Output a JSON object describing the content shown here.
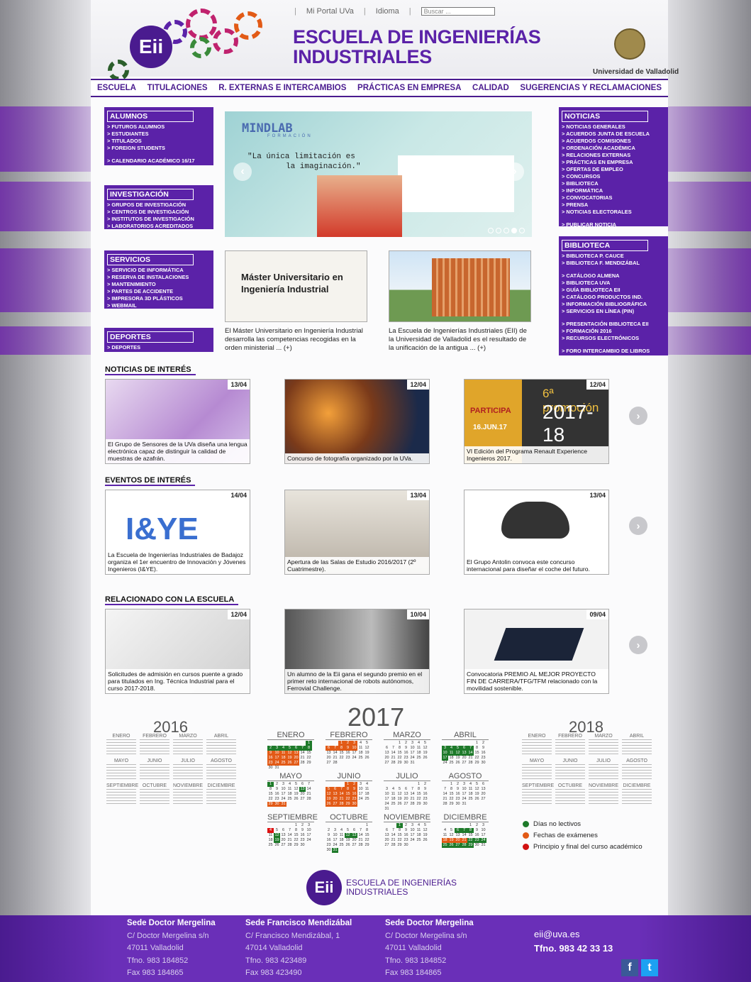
{
  "header": {
    "links": [
      "Mi Portal UVa",
      "Idioma"
    ],
    "search_placeholder": "Buscar ...",
    "title_line1": "ESCUELA DE INGENIERÍAS",
    "title_line2": "INDUSTRIALES",
    "logo_text": "Eii",
    "university": "Universidad de Valladolid"
  },
  "nav": [
    "ESCUELA",
    "TITULACIONES",
    "R. EXTERNAS E INTERCAMBIOS",
    "PRÁCTICAS EN EMPRESA",
    "CALIDAD",
    "SUGERENCIAS Y RECLAMACIONES"
  ],
  "left_boxes": [
    {
      "title": "ALUMNOS",
      "items": [
        "> FUTUROS ALUMNOS",
        "> ESTUDIANTES",
        "> TITULADOS",
        "> FOREIGN STUDENTS",
        "",
        "> CALENDARIO ACADÉMICO 16/17"
      ]
    },
    {
      "title": "INVESTIGACIÓN",
      "items": [
        "> GRUPOS DE INVESTIGACIÓN",
        "> CENTROS DE INVESTIGACIÓN",
        "> INSTITUTOS DE INVESTIGACIÓN",
        "> LABORATORIOS ACREDITADOS"
      ]
    },
    {
      "title": "SERVICIOS",
      "items": [
        "> SERVICIO DE INFORMÁTICA",
        "> RESERVA DE INSTALACIONES",
        "> MANTENIMIENTO",
        "> PARTES DE ACCIDENTE",
        "> IMPRESORA 3D PLÁSTICOS",
        "> WEBMAIL"
      ]
    },
    {
      "title": "DEPORTES",
      "items": [
        "> DEPORTES"
      ]
    }
  ],
  "right_boxes": [
    {
      "title": "NOTICIAS",
      "items": [
        "> NOTICIAS GENERALES",
        "> ACUERDOS JUNTA DE ESCUELA",
        "> ACUERDOS COMISIONES",
        "> ORDENACIÓN ACADÉMICA",
        "> RELACIONES EXTERNAS",
        "> PRÁCTICAS EN EMPRESA",
        "> OFERTAS DE EMPLEO",
        "> CONCURSOS",
        "> BIBLIOTECA",
        "> INFORMÁTICA",
        "> CONVOCATORIAS",
        "> PRENSA",
        "> NOTICIAS ELECTORALES",
        "",
        "> PUBLICAR NOTICIA"
      ]
    },
    {
      "title": "BIBLIOTECA",
      "items": [
        "> BIBLIOTECA P. CAUCE",
        "> BIBLIOTECA F. MENDIZÁBAL",
        "",
        "> CATÁLOGO ALMENA",
        "> BIBLIOTECA UVA",
        "> GUÍA BIBLIOTECA EII",
        "> CATÁLOGO PRODUCTOS IND.",
        "> INFORMACIÓN BIBLIOGRÁFICA",
        "> SERVICIOS EN LÍNEA (PIN)",
        "",
        "> PRESENTACIÓN BIBLIOTECA EII",
        "> FORMACIÓN 2016",
        "> RECURSOS ELECTRÓNICOS",
        "",
        "> FORO INTERCAMBIO DE LIBROS"
      ]
    }
  ],
  "slider": {
    "brand": "MINDLAB",
    "brand_sub": "FORMACIÓN",
    "quote1": "\"La única limitación es",
    "quote2": "la imaginación.\""
  },
  "features": [
    {
      "image_title": "Máster Universitario en Ingeniería Industrial",
      "text": "El Máster Universitario en Ingeniería Industrial desarrolla las competencias recogidas en la orden ministerial ... (+)"
    },
    {
      "text": "La Escuela de Ingenierías Industriales (EII) de la Universidad de Valladolid es el resultado de la unificación de la antigua ... (+)"
    }
  ],
  "sections": [
    {
      "title": "NOTICIAS DE INTERÉS",
      "cards": [
        {
          "date": "13/04",
          "caption": "El Grupo de Sensores de la UVa diseña una lengua electrónica capaz de distinguir la calidad de muestras de azafrán."
        },
        {
          "date": "12/04",
          "caption": "Concurso de fotografía organizado por la UVa."
        },
        {
          "date": "12/04",
          "caption": "VI Edición del Programa Renault Experience Ingenieros 2017.",
          "overlay1": "6ª promoción",
          "overlay2": "2017-18",
          "overlay3": "PARTICIPA",
          "overlay4": "16.JUN.17"
        }
      ]
    },
    {
      "title": "EVENTOS DE INTERÉS",
      "cards": [
        {
          "date": "14/04",
          "caption": "La Escuela de Ingenierías Industriales de Badajoz organiza el 1er encuentro de Innovación y Jóvenes Ingenieros (I&YE).",
          "overlay1": "I&YE"
        },
        {
          "date": "13/04",
          "caption": "Apertura de las Salas de Estudio 2016/2017 (2º Cuatrimestre)."
        },
        {
          "date": "13/04",
          "caption": "El Grupo Antolin convoca este concurso internacional para diseñar el coche del futuro."
        }
      ]
    },
    {
      "title": "RELACIONADO CON LA ESCUELA",
      "cards": [
        {
          "date": "12/04",
          "caption": "Solicitudes de admisión en cursos puente a grado para titulados en Ing. Técnica Industrial para el curso 2017-2018."
        },
        {
          "date": "10/04",
          "caption": "Un alumno de la Eii gana el segundo premio en el primer reto internacional de robots autónomos, Ferrovial Challenge."
        },
        {
          "date": "09/04",
          "caption": "Convocatoria PREMIO AL MEJOR PROYECTO FIN DE CARRERA/TFG/TFM relacionado con la movilidad sostenible."
        }
      ]
    }
  ],
  "calendar": {
    "year_prev": "2016",
    "year_main": "2017",
    "year_next": "2018",
    "months": [
      "ENERO",
      "FEBRERO",
      "MARZO",
      "ABRIL",
      "MAYO",
      "JUNIO",
      "JULIO",
      "AGOSTO",
      "SEPTIEMBRE",
      "OCTUBRE",
      "NOVIEMBRE",
      "DICIEMBRE"
    ],
    "legend": [
      {
        "label": "Días no lectivos",
        "color": "#1e7a2a"
      },
      {
        "label": "Fechas de exámenes",
        "color": "#e25a16"
      },
      {
        "label": "Principio y final del curso académico",
        "color": "#d11111"
      }
    ]
  },
  "footer_logo": {
    "line1": "ESCUELA DE INGENIERÍAS",
    "line2": "INDUSTRIALES"
  },
  "footer": {
    "cols": [
      {
        "name": "Sede Doctor Mergelina",
        "addr": "C/ Doctor Mergelina s/n",
        "city": "47011 Valladolid",
        "tel": "Tfno. 983 184852",
        "fax": "Fax 983 184865"
      },
      {
        "name": "Sede Francisco Mendizábal",
        "addr": "C/ Francisco Mendizábal, 1",
        "city": "47014 Valladolid",
        "tel": "Tfno. 983 423489",
        "fax": "Fax 983 423490"
      },
      {
        "name": "Sede Doctor Mergelina",
        "addr": "C/ Doctor Mergelina s/n",
        "city": "47011 Valladolid",
        "tel": "Tfno. 983 184852",
        "fax": "Fax 983 184865"
      }
    ],
    "email": "eii@uva.es",
    "phone": "Tfno. 983 42 33 13",
    "social": [
      "f",
      "t"
    ]
  }
}
